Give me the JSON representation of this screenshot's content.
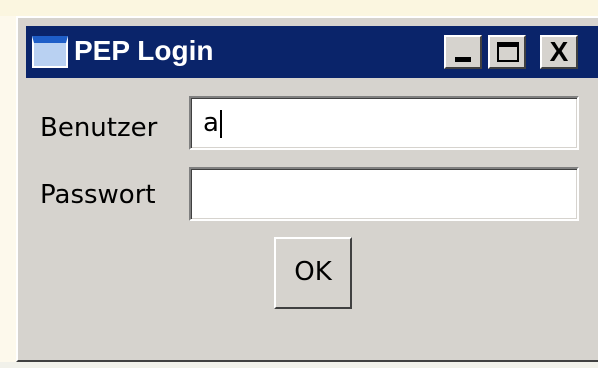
{
  "window": {
    "title": "PEP Login",
    "title_bar_color": "#0a246a",
    "face_color": "#d6d3ce",
    "controls": {
      "minimize_icon": "minimize-icon",
      "maximize_icon": "maximize-icon",
      "close_label": "X"
    }
  },
  "form": {
    "user_label": "Benutzer",
    "user_value": "a",
    "password_label": "Passwort",
    "password_value": "",
    "ok_label": "OK"
  }
}
